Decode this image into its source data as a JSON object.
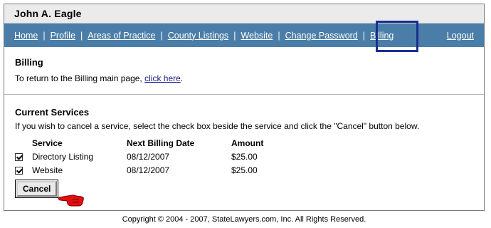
{
  "header": {
    "user_name": "John A. Eagle"
  },
  "nav": {
    "items": [
      {
        "label": "Home"
      },
      {
        "label": "Profile"
      },
      {
        "label": "Areas of Practice"
      },
      {
        "label": "County Listings"
      },
      {
        "label": "Website"
      },
      {
        "label": "Change Password"
      },
      {
        "label": "Billing"
      }
    ],
    "separator": "|",
    "logout_label": "Logout",
    "highlighted_item": "Billing",
    "highlight_color": "#1b2f8f",
    "bar_color": "#4a7ea8"
  },
  "billing": {
    "heading": "Billing",
    "text_before_link": "To return to the Billing main page, ",
    "link_label": "click here",
    "text_after_link": "."
  },
  "services": {
    "heading": "Current Services",
    "instructions": "If you wish to cancel a service, select the check box beside the service and click the \"Cancel\" button below.",
    "columns": [
      "Service",
      "Next Billing Date",
      "Amount"
    ],
    "rows": [
      {
        "checked": true,
        "service": "Directory Listing",
        "next_billing_date": "08/12/2007",
        "amount": "$25.00"
      },
      {
        "checked": true,
        "service": "Website",
        "next_billing_date": "08/12/2007",
        "amount": "$25.00"
      }
    ],
    "cancel_label": "Cancel"
  },
  "cursor": {
    "icon": "pointing-hand-cursor-icon",
    "color": "#e01010"
  },
  "footer": {
    "copyright": "Copyright © 2004 - 2007, StateLawyers.com, Inc. All Rights Reserved."
  }
}
